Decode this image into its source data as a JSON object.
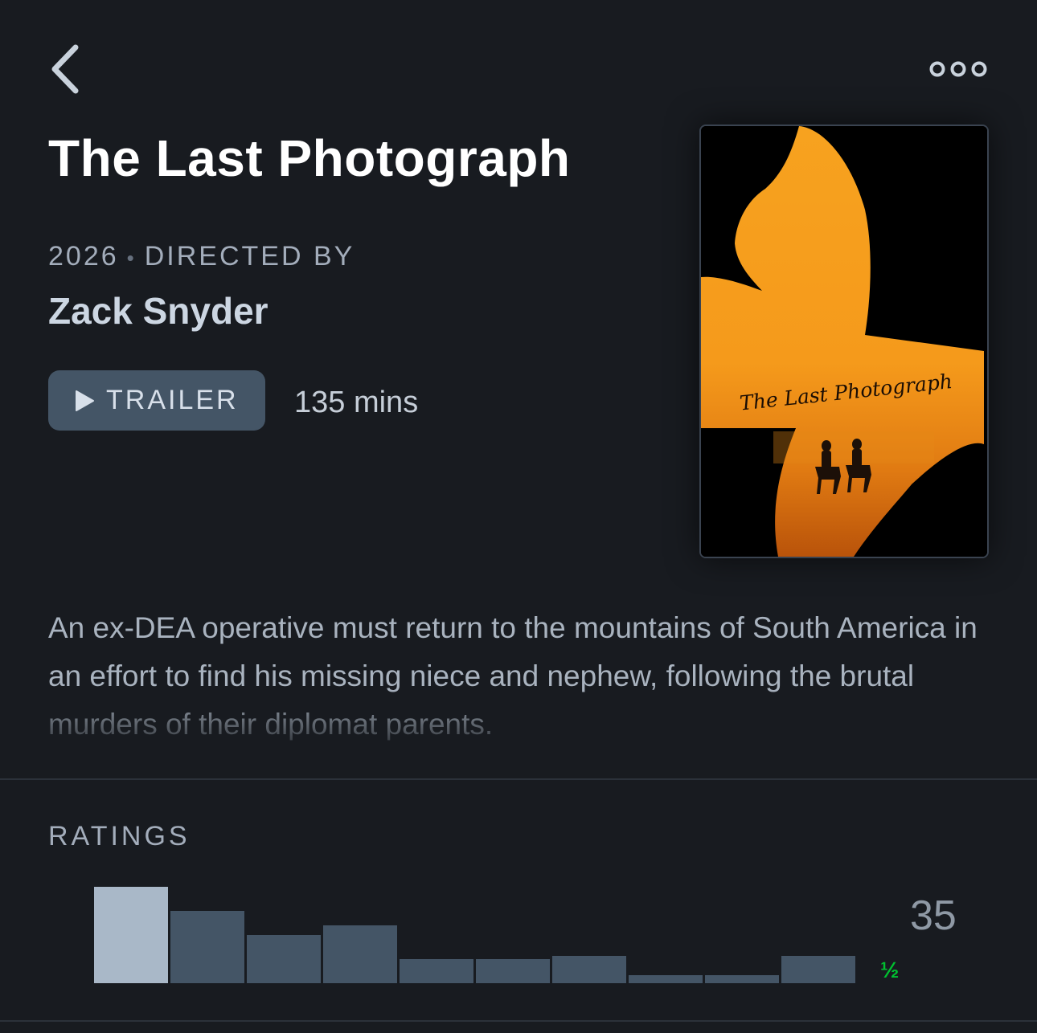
{
  "header": {
    "back_icon": "chevron-left-icon",
    "more_icon": "more-horizontal-icon"
  },
  "film": {
    "title": "The Last Photograph",
    "year": "2026",
    "directed_by_label": "DIRECTED BY",
    "director": "Zack Snyder",
    "trailer_label": "TRAILER",
    "runtime": "135 mins",
    "synopsis": "An ex-DEA operative must return to the mountains of South America in an effort to find his missing niece and nephew, following the brutal murders of their diplomat parents.",
    "poster": {
      "title_script": "The Last Photograph",
      "colors": {
        "orange": "#f59a1b",
        "deep_orange": "#c85a0a",
        "black": "#000000"
      }
    }
  },
  "ratings": {
    "label": "RATINGS",
    "count": "35",
    "low_end_marker": "½",
    "distribution": [
      1.0,
      0.75,
      0.5,
      0.6,
      0.25,
      0.25,
      0.28,
      0.08,
      0.08,
      0.28
    ],
    "colors": {
      "bar": "#445566",
      "top_bar": "#a9b8c8",
      "marker": "#00c030"
    }
  },
  "colors": {
    "background": "#181b20",
    "button": "#445566",
    "muted_text": "#a3adbb"
  }
}
